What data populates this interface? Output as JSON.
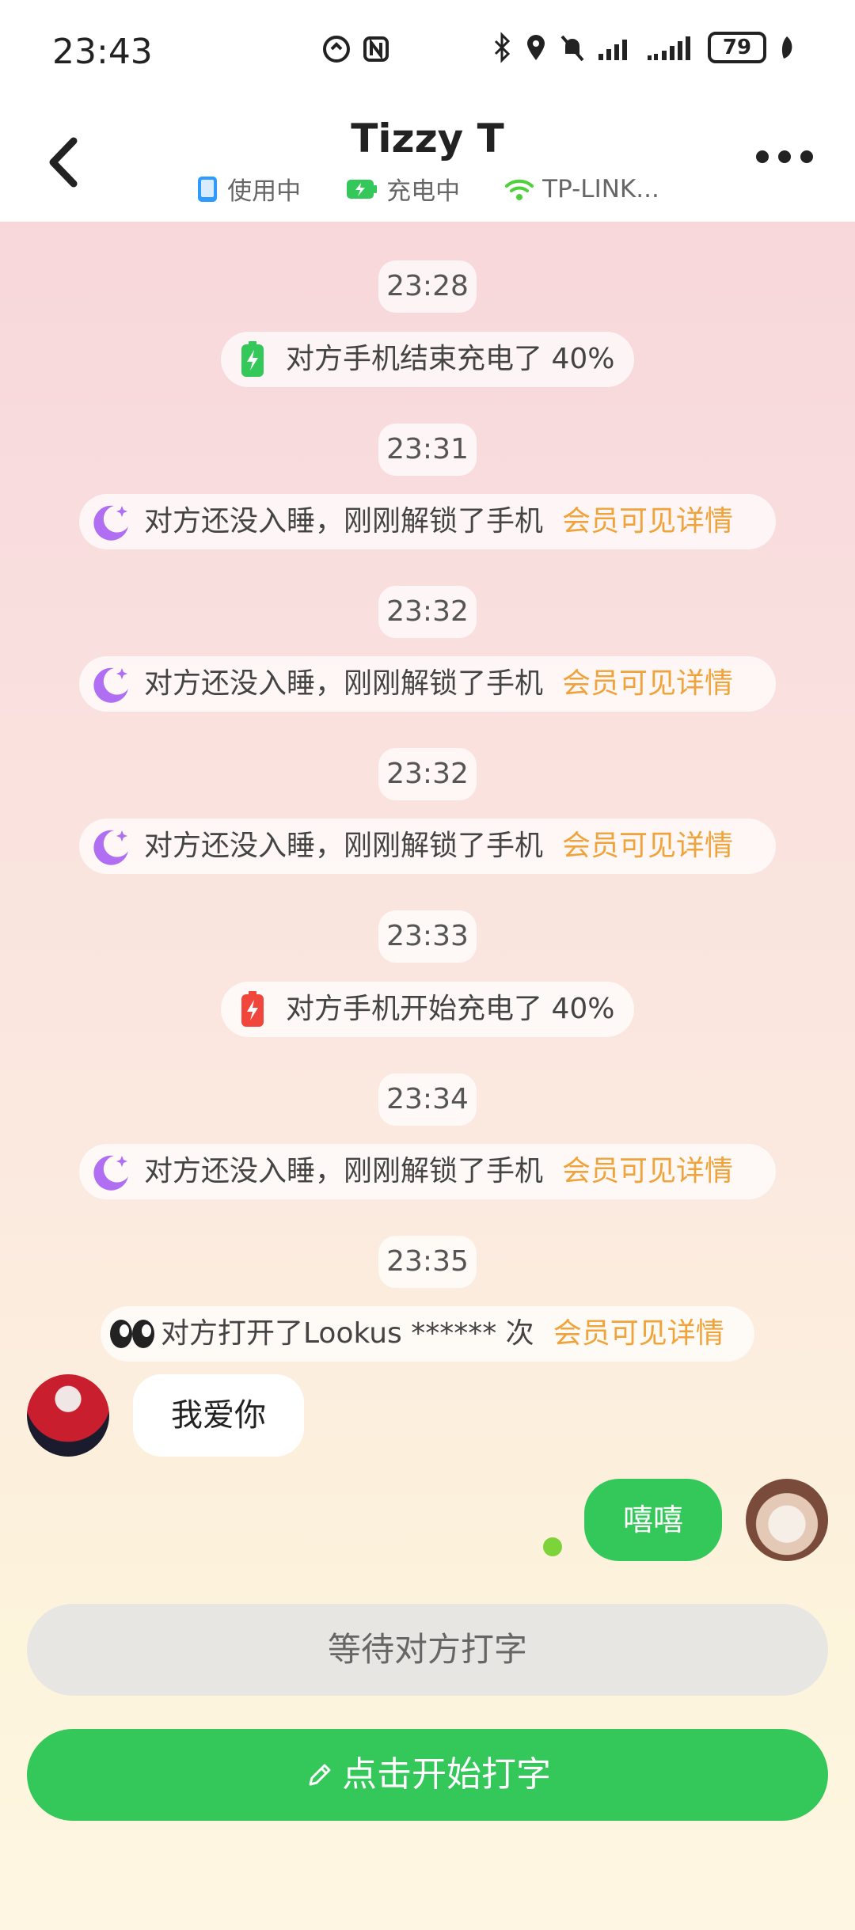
{
  "status_bar": {
    "time": "23:43",
    "battery": "79"
  },
  "header": {
    "title": "Tizzy T",
    "using_label": "使用中",
    "charging_label": "充电中",
    "wifi_label": "TP-LINK..."
  },
  "feed": {
    "vip_label": "会员可见详情",
    "items": [
      {
        "time": "23:28",
        "text": "对方手机结束充电了 40%"
      },
      {
        "time": "23:31",
        "text": "对方还没入睡，刚刚解锁了手机"
      },
      {
        "time": "23:32",
        "text": "对方还没入睡，刚刚解锁了手机"
      },
      {
        "time": "23:32",
        "text": "对方还没入睡，刚刚解锁了手机"
      },
      {
        "time": "23:33",
        "text": "对方手机开始充电了 40%"
      },
      {
        "time": "23:34",
        "text": "对方还没入睡，刚刚解锁了手机"
      },
      {
        "time": "23:35",
        "text": "对方打开了Lookus ****** 次"
      }
    ]
  },
  "chat": {
    "incoming": "我爱你",
    "outgoing": "嘻嘻"
  },
  "buttons": {
    "wait": "等待对方打字",
    "start_typing": "点击开始打字"
  },
  "colors": {
    "accent_green": "#34c759",
    "vip_orange": "#f0a33a",
    "moon_purple": "#b06ef2",
    "battery_green": "#34c759",
    "battery_red": "#f0463c"
  }
}
